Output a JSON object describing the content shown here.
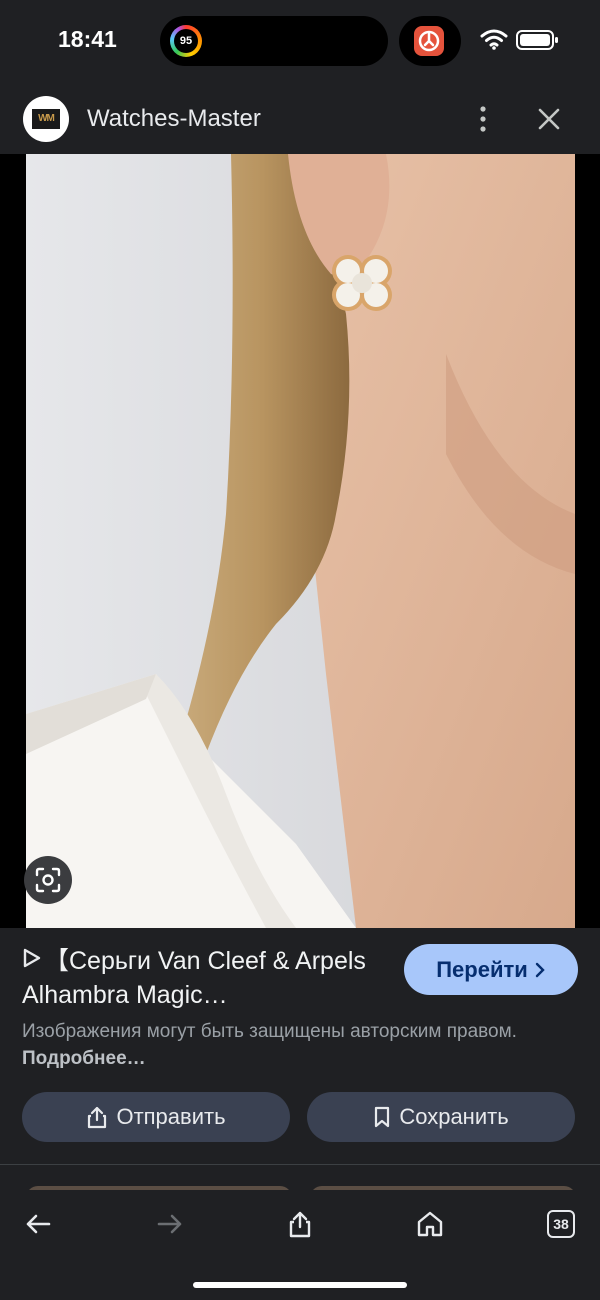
{
  "status_bar": {
    "time": "18:41",
    "activity_ring_value": "95"
  },
  "header": {
    "site_name": "Watches-Master",
    "logo_text": "WM"
  },
  "image": {
    "description_icon": "lens-icon"
  },
  "result": {
    "title": "【Серьги Van Cleef & Arpels Alhambra Magic…",
    "go_label": "Перейти",
    "copyright_text": "Изображения могут быть защищены авторским правом.",
    "more_link": "Подробнее…",
    "share_label": "Отправить",
    "save_label": "Сохранить"
  },
  "bottom_bar": {
    "tabs_count": "38"
  },
  "colors": {
    "background": "#1f2023",
    "accent": "#a8c7fa",
    "action_button": "#3a4152"
  }
}
